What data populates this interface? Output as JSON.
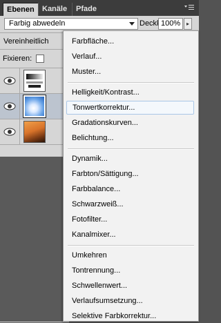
{
  "tabs": [
    {
      "label": "Ebenen",
      "active": true
    },
    {
      "label": "Kanäle",
      "active": false
    },
    {
      "label": "Pfade",
      "active": false
    }
  ],
  "panel_menu_icon": "panel-menu-icon",
  "blend": {
    "mode": "Farbig abwedeln",
    "opacity_label": "Deckkraft:",
    "opacity_value": "100%"
  },
  "unify_label": "Vereinheitlich",
  "lock_label": "Fixieren:",
  "layers": [
    {
      "thumb": "gradient-adjustment-thumbnail",
      "selected": false
    },
    {
      "thumb": "sky-thumbnail",
      "selected": true
    },
    {
      "thumb": "photo-thumbnail",
      "selected": false
    }
  ],
  "menu": {
    "group1": [
      "Farbfläche...",
      "Verlauf...",
      "Muster..."
    ],
    "group2": [
      "Helligkeit/Kontrast...",
      "Tonwertkorrektur...",
      "Gradationskurven...",
      "Belichtung..."
    ],
    "group3": [
      "Dynamik...",
      "Farbton/Sättigung...",
      "Farbbalance...",
      "Schwarzweiß...",
      "Fotofilter...",
      "Kanalmixer..."
    ],
    "group4": [
      "Umkehren",
      "Tontrennung...",
      "Schwellenwert...",
      "Verlaufsumsetzung...",
      "Selektive Farbkorrektur..."
    ],
    "hovered": "Tonwertkorrektur..."
  },
  "colors": {
    "panel_bg": "#d6d6d6",
    "tabbar_bg": "#3c3c3c",
    "menu_bg": "#f2f2f2",
    "hover_border": "#a9c6e6",
    "selection_bg": "#bcc4cf"
  }
}
